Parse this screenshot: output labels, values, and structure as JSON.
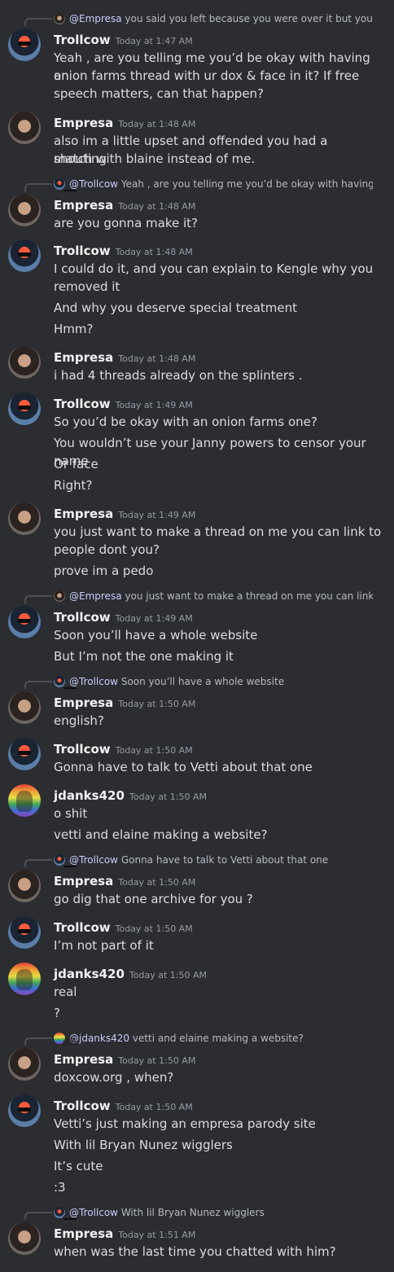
{
  "colors": {
    "background": "#2b2d31",
    "text": "#dbdee1",
    "username": "#f2f3f5",
    "timestamp": "#949ba4",
    "mention": "#c9cdfb"
  },
  "avatars": {
    "Trollcow": "trollcow-avatar",
    "Empresa": "empresa-avatar",
    "jdanks420": "jdanks-avatar"
  },
  "messages": [
    {
      "author": "Trollcow",
      "time": "Today at 1:47 AM",
      "reply": {
        "author": "Empresa",
        "mention": "@Empresa",
        "text": "you said you left because you were over it but you w"
      },
      "lines": [
        "Yeah , are you telling me you’d be okay with having an",
        "onion farms thread with ur dox & face in it? If free",
        "speech matters, can that happen?"
      ]
    },
    {
      "author": "Empresa",
      "time": "Today at 1:48 AM",
      "lines": [
        "also im a little upset and offended you had a shouting",
        "match with blaine instead of me."
      ]
    },
    {
      "author": "Empresa",
      "time": "Today at 1:48 AM",
      "reply": {
        "author": "Trollcow",
        "mention": "@Trollcow",
        "text": "Yeah , are you telling me you’d be okay with having a"
      },
      "lines": [
        "are you gonna make it?"
      ]
    },
    {
      "author": "Trollcow",
      "time": "Today at 1:48 AM",
      "lines": [
        "I could do it, and you can explain to Kengle why you",
        "removed it",
        "And why you deserve special treatment",
        "Hmm?"
      ],
      "gaps": [
        2,
        3
      ]
    },
    {
      "author": "Empresa",
      "time": "Today at 1:48 AM",
      "lines": [
        "i had 4 threads already on the splinters ."
      ]
    },
    {
      "author": "Trollcow",
      "time": "Today at 1:49 AM",
      "lines": [
        "So you’d be okay with an onion farms one?",
        "You wouldn’t use your Janny powers to censor your name",
        "Or face",
        "Right?"
      ],
      "gaps": [
        1,
        2,
        3
      ]
    },
    {
      "author": "Empresa",
      "time": "Today at 1:49 AM",
      "lines": [
        "you just want to make a thread on me you can link to",
        "people dont you?",
        "prove im a pedo"
      ],
      "gaps": [
        2
      ]
    },
    {
      "author": "Trollcow",
      "time": "Today at 1:49 AM",
      "reply": {
        "author": "Empresa",
        "mention": "@Empresa",
        "text": "you just want to make a thread on me you can link t"
      },
      "lines": [
        "Soon you’ll have a whole website",
        "But I’m not the one making it"
      ],
      "gaps": [
        1
      ]
    },
    {
      "author": "Empresa",
      "time": "Today at 1:50 AM",
      "reply": {
        "author": "Trollcow",
        "mention": "@Trollcow",
        "text": "Soon you’ll have a whole website"
      },
      "lines": [
        "english?"
      ]
    },
    {
      "author": "Trollcow",
      "time": "Today at 1:50 AM",
      "lines": [
        "Gonna have to talk to Vetti about that one"
      ]
    },
    {
      "author": "jdanks420",
      "time": "Today at 1:50 AM",
      "lines": [
        "o shit",
        "vetti and elaine making a website?"
      ],
      "gaps": [
        1
      ]
    },
    {
      "author": "Empresa",
      "time": "Today at 1:50 AM",
      "reply": {
        "author": "Trollcow",
        "mention": "@Trollcow",
        "text": "Gonna have to talk to Vetti about that one"
      },
      "lines": [
        "go dig that one archive for you ?"
      ]
    },
    {
      "author": "Trollcow",
      "time": "Today at 1:50 AM",
      "lines": [
        "I’m not part of it"
      ]
    },
    {
      "author": "jdanks420",
      "time": "Today at 1:50 AM",
      "lines": [
        "real",
        "?"
      ],
      "gaps": [
        1
      ]
    },
    {
      "author": "Empresa",
      "time": "Today at 1:50 AM",
      "reply": {
        "author": "jdanks420",
        "mention": "@jdanks420",
        "text": "vetti and elaine making a website?"
      },
      "lines": [
        "doxcow.org , when?"
      ]
    },
    {
      "author": "Trollcow",
      "time": "Today at 1:50 AM",
      "lines": [
        "Vetti’s just making an empresa parody site",
        "With lil Bryan Nunez wigglers",
        "It’s cute",
        ":3"
      ],
      "gaps": [
        1,
        2,
        3
      ]
    },
    {
      "author": "Empresa",
      "time": "Today at 1:51 AM",
      "reply": {
        "author": "Trollcow",
        "mention": "@Trollcow",
        "text": "With lil Bryan Nunez wigglers"
      },
      "lines": [
        "when was the last time you chatted with him?"
      ]
    }
  ]
}
